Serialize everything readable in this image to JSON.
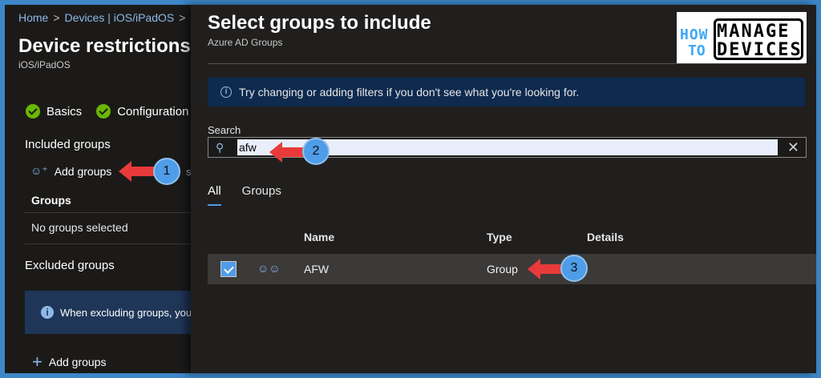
{
  "left": {
    "breadcrumb": [
      "Home",
      "Devices | iOS/iPadOS"
    ],
    "title": "Device restrictions",
    "subtitle": "iOS/iPadOS",
    "steps": [
      "Basics",
      "Configuration"
    ],
    "included_heading": "Included groups",
    "add_groups": "Add groups",
    "faded_text": "se",
    "groups_column": "Groups",
    "no_groups": "No groups selected",
    "excluded_heading": "Excluded groups",
    "info_text": "When excluding groups, you c",
    "add_groups_2": "Add groups"
  },
  "blade": {
    "title": "Select groups to include",
    "subtitle": "Azure AD Groups",
    "banner": "Try changing or adding filters if you don't see what you're looking for.",
    "search_label": "Search",
    "search_value": "afw",
    "tabs": [
      "All",
      "Groups"
    ],
    "columns": [
      "Name",
      "Type",
      "Details"
    ],
    "rows": [
      {
        "name": "AFW",
        "type": "Group",
        "details": ""
      }
    ]
  },
  "logo": {
    "how": "HOW",
    "to": "TO",
    "manage": "MANAGE",
    "devices": "DEVICES"
  },
  "annotations": [
    "1",
    "2",
    "3"
  ],
  "colors": {
    "accent": "#4f9ce8",
    "frame": "#3d87c9",
    "arrow": "#e83a3a",
    "success": "#6bb700"
  }
}
